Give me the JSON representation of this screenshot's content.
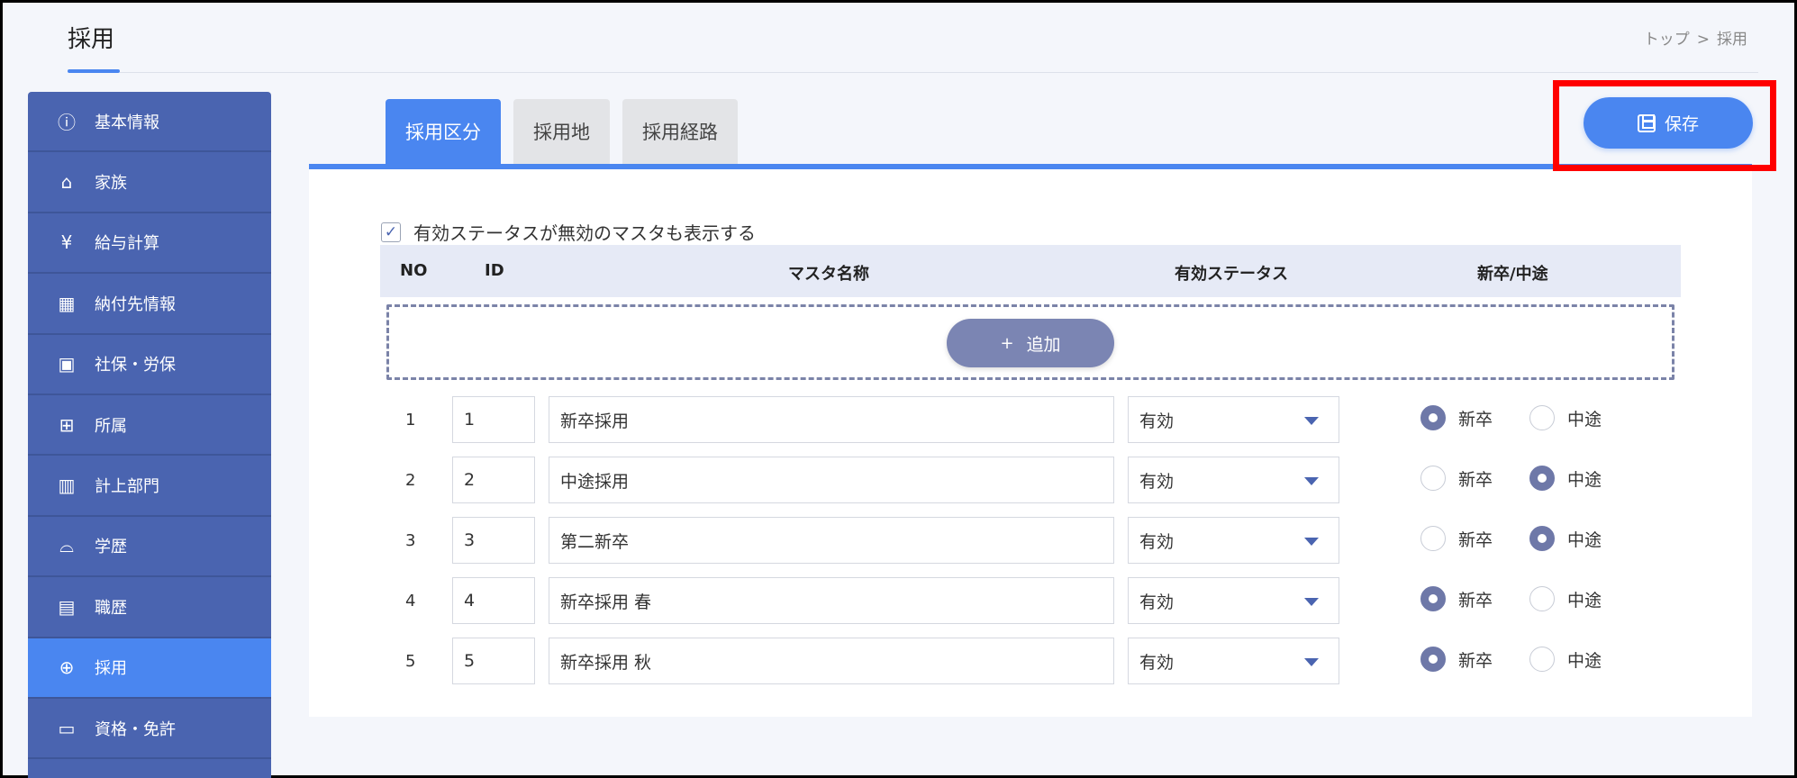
{
  "header": {
    "title": "採用",
    "breadcrumb": [
      "トップ",
      ">",
      "採用"
    ]
  },
  "sidebar": {
    "items": [
      {
        "label": "基本情報",
        "icon": "info-icon",
        "glyph": "ⓘ",
        "active": false
      },
      {
        "label": "家族",
        "icon": "family-icon",
        "glyph": "⌂",
        "active": false
      },
      {
        "label": "給与計算",
        "icon": "yen-icon",
        "glyph": "¥",
        "active": false
      },
      {
        "label": "納付先情報",
        "icon": "building-icon",
        "glyph": "▦",
        "active": false
      },
      {
        "label": "社保・労保",
        "icon": "insurance-icon",
        "glyph": "▣",
        "active": false
      },
      {
        "label": "所属",
        "icon": "org-chart-icon",
        "glyph": "⊞",
        "active": false
      },
      {
        "label": "計上部門",
        "icon": "department-chart-icon",
        "glyph": "▥",
        "active": false
      },
      {
        "label": "学歴",
        "icon": "graduation-cap-icon",
        "glyph": "⌓",
        "active": false
      },
      {
        "label": "職歴",
        "icon": "resume-icon",
        "glyph": "▤",
        "active": true,
        "activeFlag": false
      },
      {
        "label": "採用",
        "icon": "recruit-search-icon",
        "glyph": "⊕",
        "active": true
      },
      {
        "label": "資格・免許",
        "icon": "license-icon",
        "glyph": "▭",
        "active": false
      }
    ]
  },
  "tabs": [
    {
      "label": "採用区分",
      "active": true
    },
    {
      "label": "採用地",
      "active": false
    },
    {
      "label": "採用経路",
      "active": false
    }
  ],
  "toolbar": {
    "save_label": "保存"
  },
  "filter": {
    "show_invalid_label": "有効ステータスが無効のマスタも表示する",
    "checked": true,
    "check_glyph": "✓"
  },
  "table": {
    "headers": {
      "no": "NO",
      "id": "ID",
      "name": "マスタ名称",
      "status": "有効ステータス",
      "type": "新卒/中途"
    },
    "add_label": "追加",
    "add_glyph": "+",
    "radio_labels": {
      "new": "新卒",
      "mid": "中途"
    },
    "rows": [
      {
        "no": "1",
        "id": "1",
        "name": "新卒採用",
        "status": "有効",
        "type": "new"
      },
      {
        "no": "2",
        "id": "2",
        "name": "中途採用",
        "status": "有効",
        "type": "mid"
      },
      {
        "no": "3",
        "id": "3",
        "name": "第二新卒",
        "status": "有効",
        "type": "mid"
      },
      {
        "no": "4",
        "id": "4",
        "name": "新卒採用 春",
        "status": "有効",
        "type": "new"
      },
      {
        "no": "5",
        "id": "5",
        "name": "新卒採用 秋",
        "status": "有効",
        "type": "new"
      }
    ]
  },
  "colors": {
    "accent": "#4a86f0",
    "sidebar": "#4a64b0",
    "highlight": "#ff0000"
  }
}
